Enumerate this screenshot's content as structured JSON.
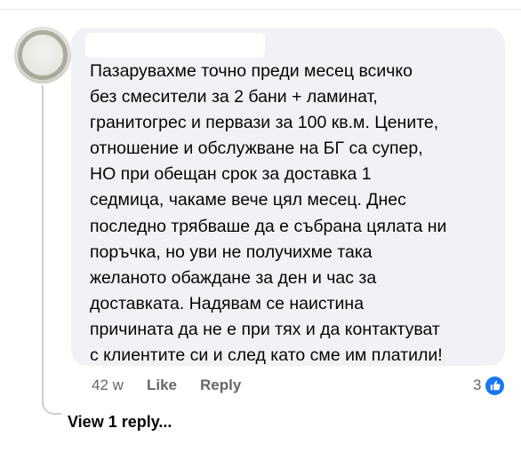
{
  "comment": {
    "text_lines": [
      "Пазарувахме точно преди месец всичко",
      "без смесители за 2 бани + ламинат,",
      "гранитогрес и первази за 100 кв.м. Цените,",
      "отношение и обслужване на БГ са супер,",
      "НО при обещан срок за доставка 1",
      "седмица, чакаме вече цял месец. Днес",
      "последно трябваше да е събрана цялата ни",
      "поръчка, но уви не получихме така",
      "желаното обаждане за ден и час за",
      "доставката. Надявам се наистина",
      "причината да не е при тях и да контактуват",
      "с клиентите си и след като сме им платили!"
    ],
    "timestamp": "42 w",
    "like_label": "Like",
    "reply_label": "Reply",
    "reaction_count": "3",
    "reaction_icon": "thumbs-up-icon"
  },
  "replies": {
    "view_label": "View 1 reply..."
  },
  "colors": {
    "bubble": "#f0f2f5",
    "meta_text": "#65676b",
    "like_blue": "#1877f2"
  }
}
